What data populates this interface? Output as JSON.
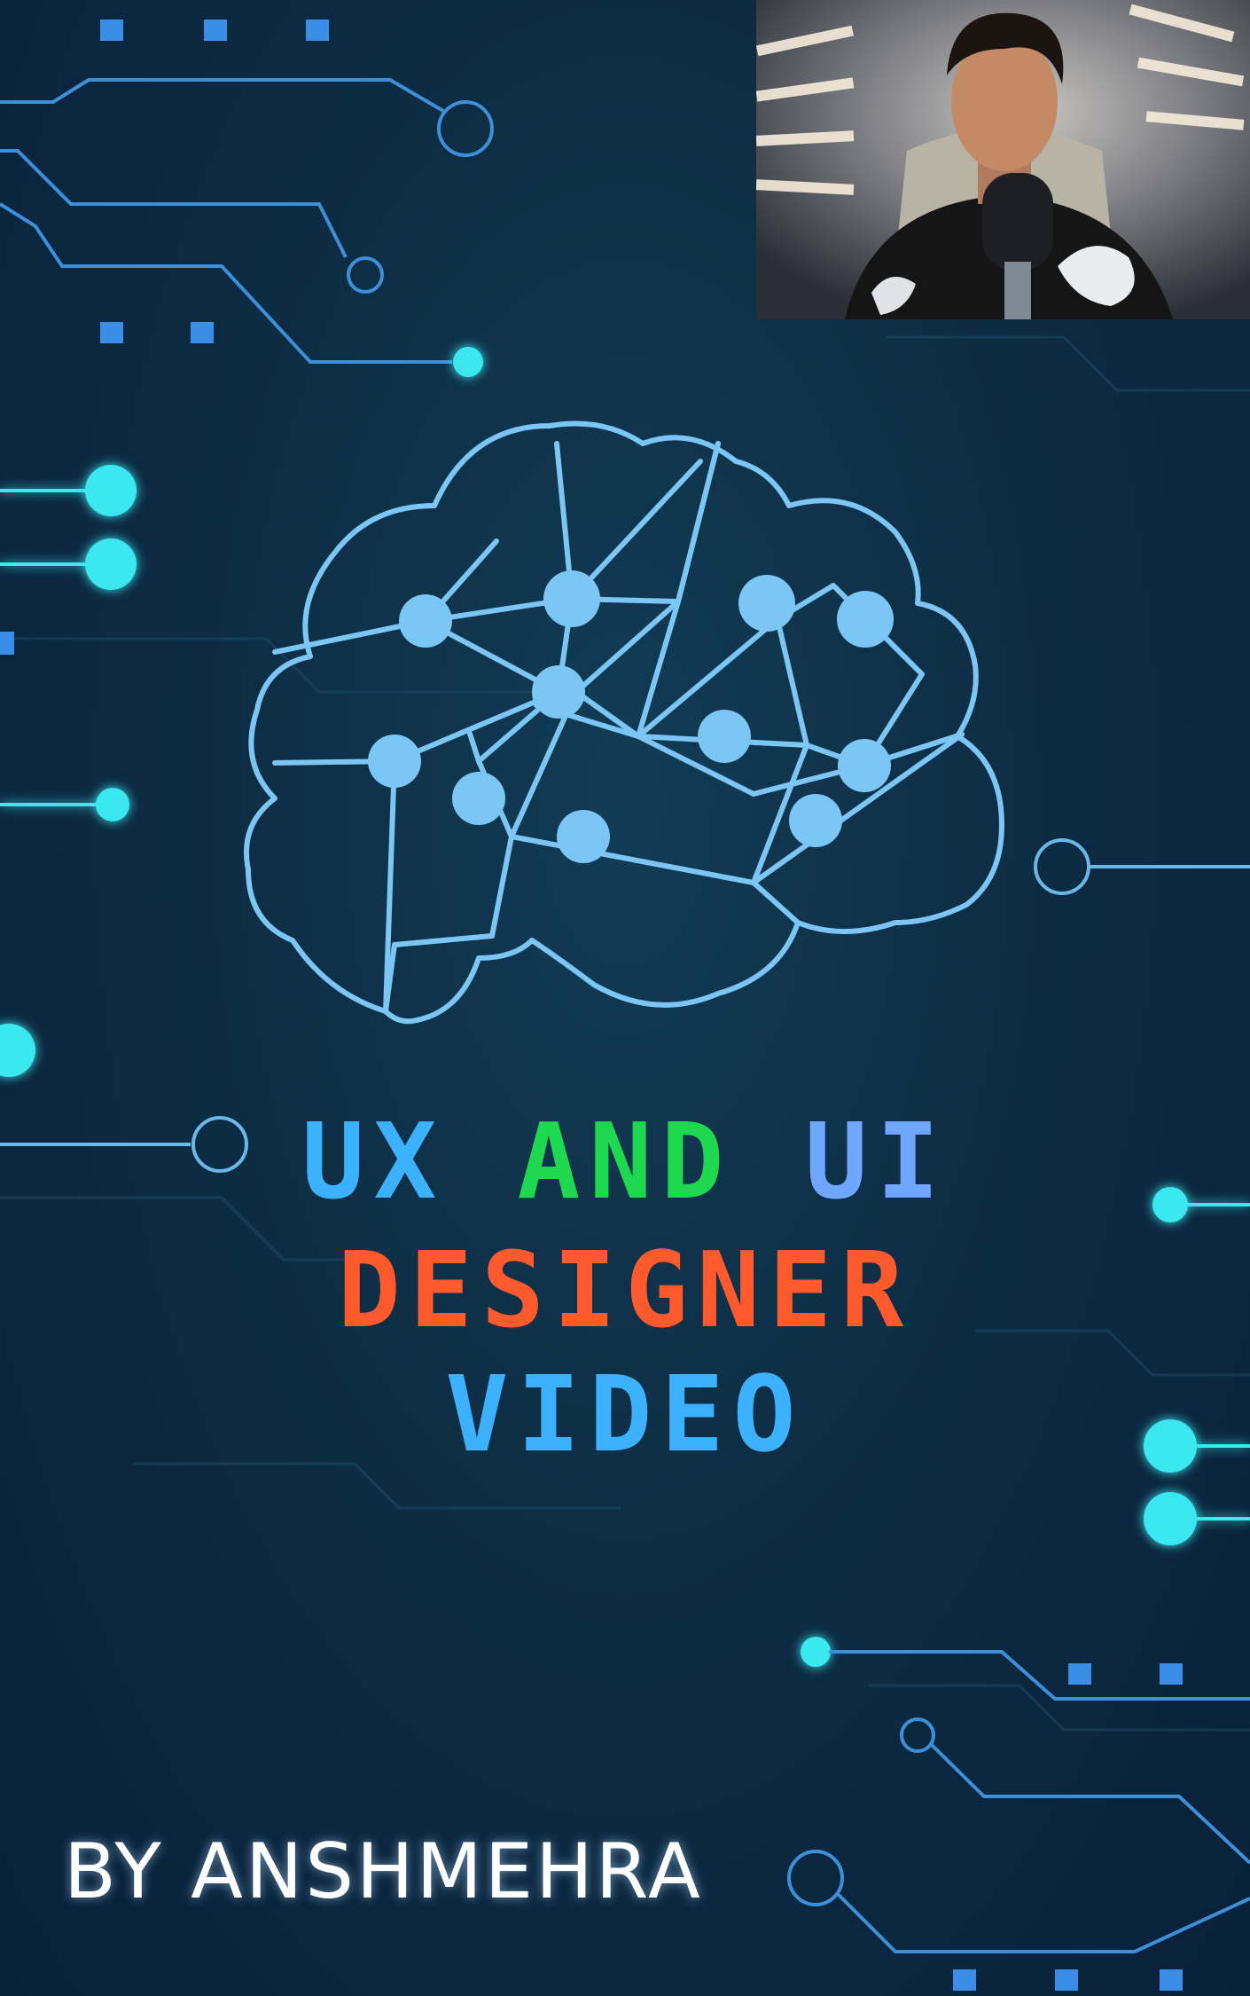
{
  "title": {
    "word_ux": "UX",
    "word_and": "AND",
    "word_ui": "UI",
    "line2": "DESIGNER",
    "line3": "VIDEO"
  },
  "author": "BY ANSHMEHRA",
  "colors": {
    "background": "#0d2d44",
    "circuit_glow": "#3ae8f0",
    "brain_stroke": "#7cc6f5",
    "title_blue": "#3cb2ff",
    "title_green": "#1ed84f",
    "title_orange": "#ff5a2e",
    "author_text": "#ffffff"
  },
  "icons": {
    "brain": "brain-network-icon",
    "webcam": "presenter-webcam"
  }
}
